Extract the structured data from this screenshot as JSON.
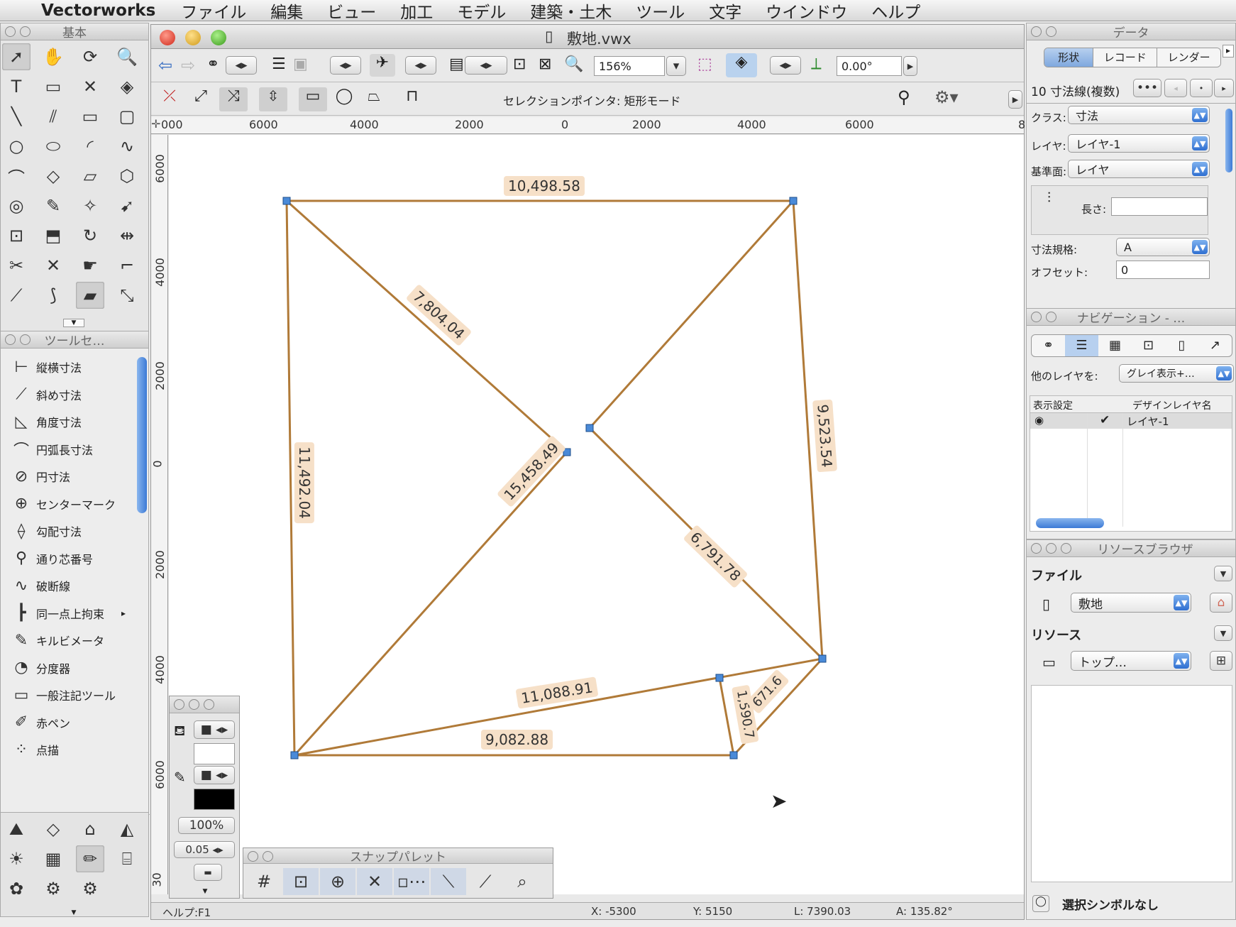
{
  "menu": {
    "app": "Vectorworks",
    "items": [
      "ファイル",
      "編集",
      "ビュー",
      "加工",
      "モデル",
      "建築・土木",
      "ツール",
      "文字",
      "ウインドウ",
      "ヘルプ"
    ]
  },
  "palettes": {
    "basic": "基本",
    "toolset": "ツールセ…",
    "data": "データ",
    "navigation": "ナビゲーション - …",
    "resource": "リソースブラウザ",
    "snap": "スナップパレット"
  },
  "toolset_items": [
    "縦横寸法",
    "斜め寸法",
    "角度寸法",
    "円弧長寸法",
    "円寸法",
    "センターマーク",
    "勾配寸法",
    "通り芯番号",
    "破断線",
    "同一点上拘束",
    "キルビメータ",
    "分度器",
    "一般注記ツール",
    "赤ペン",
    "点描"
  ],
  "toolset_icons": [
    "h-dimension-icon",
    "diagonal-dimension-icon",
    "angle-dimension-icon",
    "arc-length-icon",
    "circle-dimension-icon",
    "center-mark-icon",
    "slope-dimension-icon",
    "grid-bubble-icon",
    "break-line-icon",
    "constraint-icon",
    "kilbi-meter-icon",
    "protractor-icon",
    "callout-icon",
    "red-pen-icon",
    "stipple-icon"
  ],
  "document": {
    "title": "敷地.vwx",
    "zoom": "156%",
    "angle": "0.00°",
    "mode_text": "セレクションポインタ: 矩形モード"
  },
  "ruler": {
    "top": [
      "000",
      "6000",
      "4000",
      "2000",
      "0",
      "2000",
      "4000",
      "6000",
      "8"
    ],
    "left": [
      "6000",
      "4000",
      "2000",
      "0",
      "2000",
      "4000",
      "6000",
      "30"
    ]
  },
  "dimensions": [
    "10,498.58",
    "7,804.04",
    "11,492.04",
    "15,458.49",
    "9,523.54",
    "6,791.78",
    "11,088.91",
    "9,082.88",
    "1,590.7",
    "671.6"
  ],
  "attributes": {
    "percent": "100%",
    "lineweight": "0.05"
  },
  "data_palette": {
    "tabs": [
      "形状",
      "レコード",
      "レンダー"
    ],
    "object": "10 寸法線(複数)",
    "class_label": "クラス:",
    "class_value": "寸法",
    "layer_label": "レイヤ:",
    "layer_value": "レイヤ-1",
    "plane_label": "基準面:",
    "plane_value": "レイヤ",
    "length_label": "長さ:",
    "length_value": "",
    "standard_label": "寸法規格:",
    "standard_value": "A",
    "offset_label": "オフセット:",
    "offset_value": "0"
  },
  "navigation": {
    "other_layers_label": "他のレイヤを:",
    "other_layers_value": "グレイ表示+…",
    "col1": "表示設定",
    "col2": "デザインレイヤ名",
    "row_name": "レイヤ-1"
  },
  "resource": {
    "file_label": "ファイル",
    "file_value": "敷地",
    "res_label": "リソース",
    "res_value": "トップ…",
    "footer": "選択シンボルなし"
  },
  "statusbar": {
    "help": "ヘルプ:F1",
    "x": "X: -5300",
    "y": "Y: 5150",
    "l": "L: 7390.03",
    "a": "A: 135.82°"
  },
  "colors": {
    "line": "#b07a38",
    "handle": "#4a8ad8",
    "label_bg": "#f6e0c8",
    "accent": "#2f6fd1"
  }
}
